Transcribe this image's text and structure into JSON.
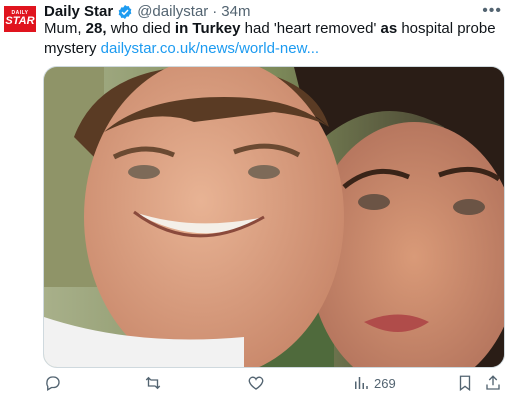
{
  "account": {
    "logo_top": "DAILY",
    "logo_bottom": "STAR",
    "name": "Daily Star",
    "handle": "@dailystar",
    "separator": "·",
    "time": "34m"
  },
  "tweet": {
    "t1": "Mum, ",
    "b1": "28,",
    "t2": " who died ",
    "b2": "in Turkey",
    "t3": " had 'heart removed' ",
    "b3": "as",
    "t4": " hospital probe mystery ",
    "link": "dailystar.co.uk/news/world-new..."
  },
  "actions": {
    "views": "269"
  },
  "icons": {
    "more": "more-icon",
    "reply": "reply-icon",
    "retweet": "retweet-icon",
    "like": "like-icon",
    "views": "views-icon",
    "bookmark": "bookmark-icon",
    "share": "share-icon"
  },
  "colors": {
    "brand": "#e0141e",
    "link": "#1d9bf0",
    "verified": "#1d9bf0",
    "muted": "#536471"
  }
}
